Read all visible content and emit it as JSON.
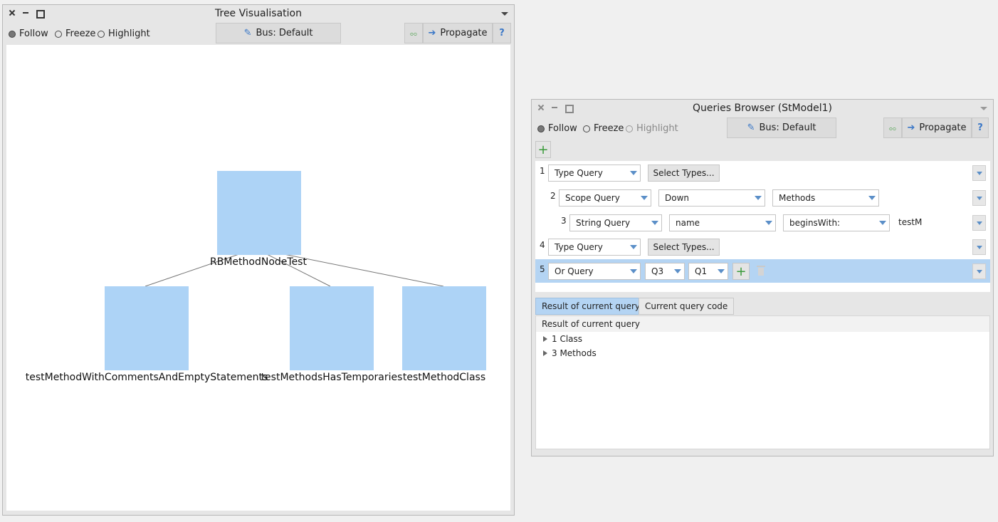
{
  "tree_window": {
    "title": "Tree Visualisation",
    "radios": [
      {
        "label": "Follow",
        "selected": true
      },
      {
        "label": "Freeze",
        "selected": false
      },
      {
        "label": "Highlight",
        "selected": false
      }
    ],
    "bus_label": "Bus: Default",
    "propagate_label": "Propagate",
    "help_label": "?",
    "nodes": {
      "root": "RBMethodNodeTest",
      "child1": "testMethodWithCommentsAndEmptyStatements",
      "child2": "testMethodsHasTemporaries",
      "child3": "testMethodClass"
    },
    "node_color": "#add3f6"
  },
  "queries_window": {
    "title": "Queries Browser (StModel1)",
    "radios": [
      {
        "label": "Follow",
        "selected": true
      },
      {
        "label": "Freeze",
        "selected": false
      },
      {
        "label": "Highlight",
        "selected": false,
        "disabled": true
      }
    ],
    "bus_label": "Bus: Default",
    "propagate_label": "Propagate",
    "help_label": "?",
    "add_label": "+",
    "queries": [
      {
        "num": "1",
        "type": "Type Query",
        "button": "Select Types..."
      },
      {
        "num": "2",
        "type": "Scope Query",
        "direction": "Down",
        "target": "Methods"
      },
      {
        "num": "3",
        "type": "String Query",
        "property": "name",
        "operator": "beginsWith:",
        "value": "testM"
      },
      {
        "num": "4",
        "type": "Type Query",
        "button": "Select Types..."
      },
      {
        "num": "5",
        "type": "Or Query",
        "left": "Q3",
        "right": "Q1",
        "add": "+",
        "selected": true
      }
    ],
    "tabs": [
      "Result of current query",
      "Current query code"
    ],
    "result_header": "Result of current query",
    "results": [
      "1 Class",
      "3 Methods"
    ],
    "selection_color": "#b4d4f3"
  }
}
